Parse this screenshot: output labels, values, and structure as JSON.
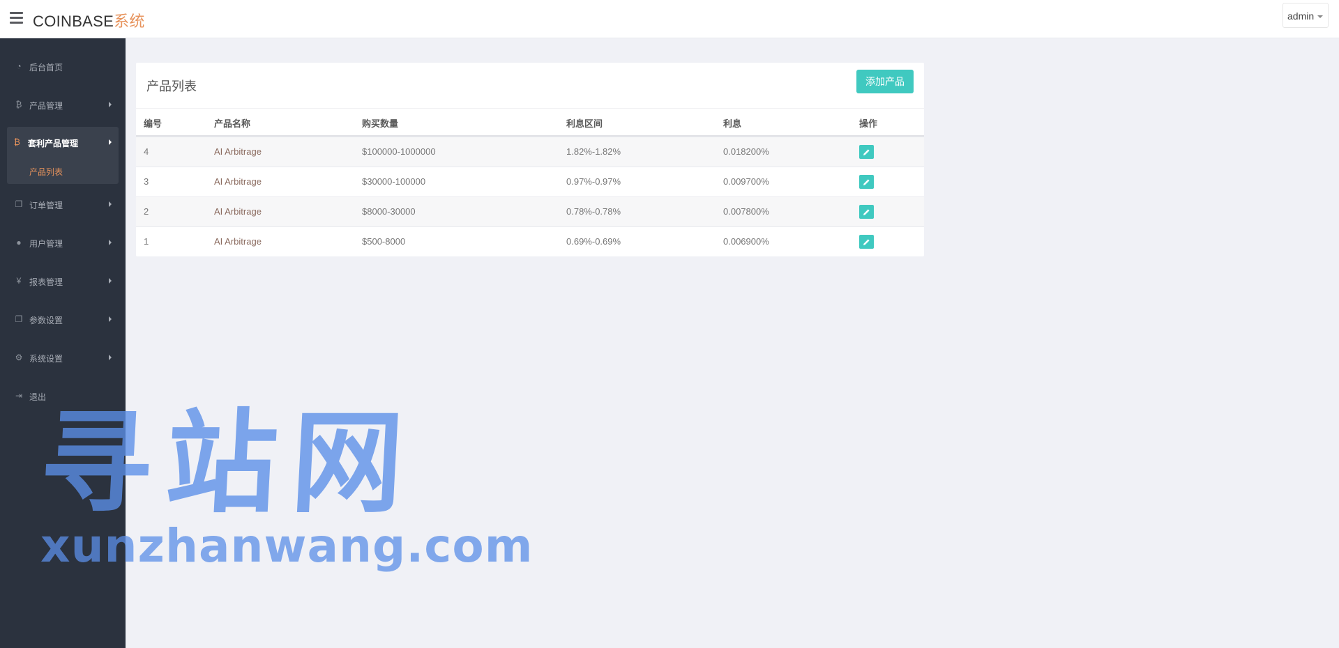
{
  "brand": {
    "main": "COINBASE",
    "accent": "系统"
  },
  "user": {
    "name": "admin"
  },
  "sidebar": {
    "items": [
      {
        "label": "后台首页",
        "icon": "dashboard-icon",
        "glyph": "◔"
      },
      {
        "label": "产品管理",
        "icon": "bitcoin-icon",
        "glyph": "₿"
      },
      {
        "label": "套利产品管理",
        "icon": "bitcoin-icon",
        "glyph": "₿",
        "sub": "产品列表"
      },
      {
        "label": "订单管理",
        "icon": "copy-icon",
        "glyph": "❐"
      },
      {
        "label": "用户管理",
        "icon": "user-icon",
        "glyph": "●"
      },
      {
        "label": "报表管理",
        "icon": "yen-icon",
        "glyph": "¥"
      },
      {
        "label": "参数设置",
        "icon": "copy-icon",
        "glyph": "❐"
      },
      {
        "label": "系统设置",
        "icon": "gears-icon",
        "glyph": "⚙"
      },
      {
        "label": "退出",
        "icon": "sign-out-icon",
        "glyph": "⇥"
      }
    ]
  },
  "panel": {
    "title": "产品列表",
    "add_button": "添加产品",
    "columns": [
      "编号",
      "产品名称",
      "购买数量",
      "利息区间",
      "利息",
      "操作"
    ],
    "rows": [
      {
        "id": "4",
        "name": "AI Arbitrage",
        "qty": "$100000-1000000",
        "range": "1.82%-1.82%",
        "rate": "0.018200%"
      },
      {
        "id": "3",
        "name": "AI Arbitrage",
        "qty": "$30000-100000",
        "range": "0.97%-0.97%",
        "rate": "0.009700%"
      },
      {
        "id": "2",
        "name": "AI Arbitrage",
        "qty": "$8000-30000",
        "range": "0.78%-0.78%",
        "rate": "0.007800%"
      },
      {
        "id": "1",
        "name": "AI Arbitrage",
        "qty": "$500-8000",
        "range": "0.69%-0.69%",
        "rate": "0.006900%"
      }
    ]
  },
  "watermark": {
    "big": "寻站网",
    "small": "xunzhanwang.com"
  },
  "colors": {
    "accent": "#40c9c0",
    "brand_orange": "#e7935c",
    "sidebar": "#2b323e"
  }
}
